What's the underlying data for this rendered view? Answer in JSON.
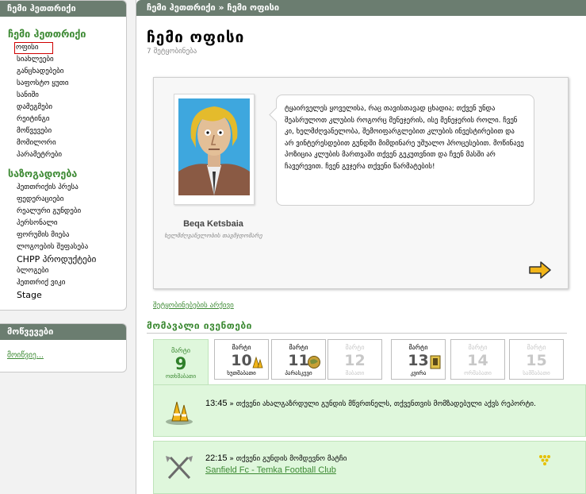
{
  "left": {
    "header": "ჩემი ჰეთთრიქი",
    "section1_title": "ჩემი ჰეთთრიქი",
    "section1_items": [
      "ოფისი",
      "სიახლეები",
      "განცხადებები",
      "საფოსტო ყუთი",
      "სანიში",
      "დამეგმები",
      "რეიტინგი",
      "მოწვევები",
      "მომილორი",
      "პარამეტრები"
    ],
    "section2_title": "საზოგადოება",
    "section2_items": [
      "ჰეთთრიქის პრესა",
      "ფედერაციები",
      "რეალური გუნდები",
      "პერსონალი",
      "ფორუმის მიება",
      "ლოგოების შეფასება",
      "CHPP პროდუქტები",
      "ბლოგები",
      "ჰეთთრიქ ვიკი",
      "Stage"
    ],
    "invites_header": "მოწვევები",
    "invites_link": "მოიწვიე..."
  },
  "main": {
    "header": "ჩემი ჰეთთრიქი » ჩემი ოფისი",
    "title": "ჩემი ოფისი",
    "subtitle": "7 შეტყობინება",
    "message": {
      "author": "Beqa Ketsbaia",
      "role": "ხელმძღვანელობის თავმჯდომარე",
      "text": "ტყაირველეს ყოველისა, რაც თავისთავად ცხადია; თქვენ უნდა შეასრულოთ კლუბის როგორც მენეჯერის, ისე მენეჯერის როლი. ჩვენ კი, ხელმძღვანელობა, შემოიფარგლებით კლუბის ინვესტირებით და არ ვინტერესდებით გუნდში მიმდინარე უშუალო პროცესებით. მოწინავე პოზიცია კლუბის მართვაში თქვენ გეკუთვნით და ჩვენ მასში არ ჩავერევით. ჩვენ გვჯერა თქვენი წარმატების!"
    },
    "archive_link": "შეტყობინებების არქივი",
    "events_title": "მომავალი ივენთები",
    "calendar": [
      {
        "month": "მარტი",
        "day": "9",
        "weekday": "ოთხშაბათი",
        "today": true,
        "dim": false,
        "icon": ""
      },
      {
        "month": "მარტი",
        "day": "10",
        "weekday": "ხუთშაბათი",
        "today": false,
        "dim": false,
        "icon": "cones-icon"
      },
      {
        "month": "მარტი",
        "day": "11",
        "weekday": "პარასკევი",
        "today": false,
        "dim": false,
        "icon": "globe-icon"
      },
      {
        "month": "მარტი",
        "day": "12",
        "weekday": "შაბათი",
        "today": false,
        "dim": true,
        "icon": ""
      },
      {
        "month": "მარტი",
        "day": "13",
        "weekday": "კვირა",
        "today": false,
        "dim": false,
        "icon": "card-icon"
      },
      {
        "month": "მარტი",
        "day": "14",
        "weekday": "ორშაბათი",
        "today": false,
        "dim": true,
        "icon": ""
      },
      {
        "month": "მარტი",
        "day": "15",
        "weekday": "სამშაბათი",
        "today": false,
        "dim": true,
        "icon": ""
      }
    ],
    "events": [
      {
        "time": "13:45",
        "text": " » თქვენი ახალგაზრდული გუნდის მწვრთნელს, თქვენთვის მომზადებული აქვს რეპორტი.",
        "link": ""
      },
      {
        "time": "22:15",
        "text": " » თქვენი გუნდის მომდევნო მატჩი",
        "link": "Sanfield Fc - Temka Football Club"
      }
    ]
  },
  "colors": {
    "header_bg": "#6b7d70",
    "accent_green": "#3d8a34",
    "event_bg": "#dff7dc"
  }
}
